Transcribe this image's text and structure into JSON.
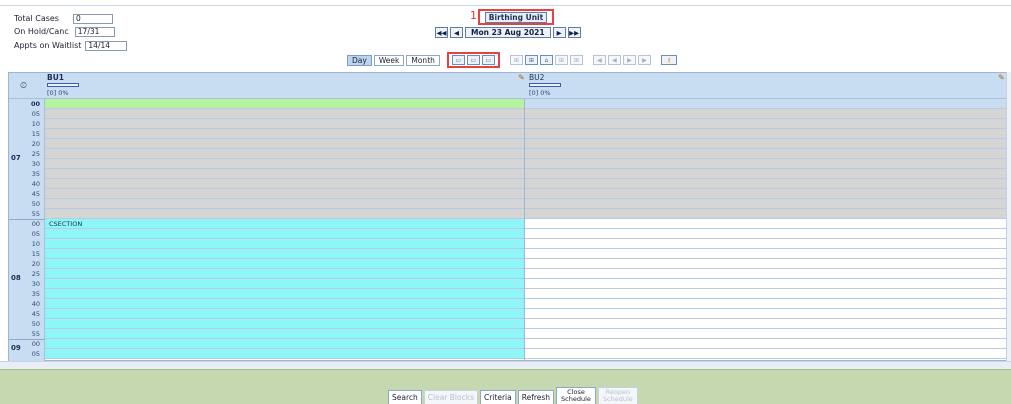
{
  "summary": {
    "total_cases_label": "Total Cases",
    "total_cases_value": "0",
    "on_hold_label": "On Hold/Canc",
    "on_hold_value": "17/31",
    "waitlist_label": "Appts on Waitlist",
    "waitlist_value": "14/14"
  },
  "annotation": {
    "marker": "1"
  },
  "unit": {
    "title": "Birthing Unit"
  },
  "nav": {
    "first": "◀◀",
    "prev": "◀",
    "date": "Mon 23 Aug 2021",
    "next": "▶",
    "last": "▶▶"
  },
  "views": {
    "day": "Day",
    "week": "Week",
    "month": "Month",
    "active": "Day"
  },
  "columns": [
    {
      "name": "BU1",
      "pct": "[0] 0%"
    },
    {
      "name": "BU2",
      "pct": "[0] 0%"
    }
  ],
  "schedule": {
    "hours": [
      "07",
      "08",
      "09"
    ],
    "minutes_07": [
      "00",
      "05",
      "10",
      "15",
      "20",
      "25",
      "30",
      "35",
      "40",
      "45",
      "50",
      "55"
    ],
    "minutes_08": [
      "00",
      "05",
      "10",
      "15",
      "20",
      "25",
      "30",
      "35",
      "40",
      "45",
      "50",
      "55"
    ],
    "minutes_09": [
      "00",
      "05"
    ],
    "block_label": "CSECTION",
    "colors": {
      "available": "#b5f3a0",
      "blocked": "#d5d5d5",
      "csection": "#8ff6f8",
      "open": "#ffffff"
    }
  },
  "footer": {
    "search": "Search",
    "clear_blocks": "Clear Blocks",
    "criteria": "Criteria",
    "refresh": "Refresh",
    "close_line1": "Close",
    "close_line2": "Schedule",
    "reopen_line1": "Reopen",
    "reopen_line2": "Schedule"
  }
}
